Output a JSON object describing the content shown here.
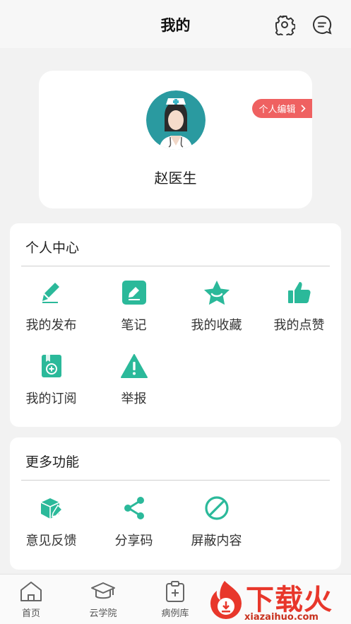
{
  "header": {
    "title": "我的",
    "settings_icon": "gear-icon",
    "message_icon": "message-icon"
  },
  "profile": {
    "name": "赵医生",
    "edit_label": "个人编辑",
    "avatar": "nurse-avatar"
  },
  "personal_center": {
    "title": "个人中心",
    "items": [
      {
        "label": "我的发布",
        "icon": "pencil-icon"
      },
      {
        "label": "笔记",
        "icon": "note-edit-icon"
      },
      {
        "label": "我的收藏",
        "icon": "star-icon"
      },
      {
        "label": "我的点赞",
        "icon": "thumbs-up-icon"
      },
      {
        "label": "我的订阅",
        "icon": "subscribe-book-icon"
      },
      {
        "label": "举报",
        "icon": "warning-icon"
      }
    ]
  },
  "more_functions": {
    "title": "更多功能",
    "items": [
      {
        "label": "意见反馈",
        "icon": "feedback-box-icon"
      },
      {
        "label": "分享码",
        "icon": "share-icon"
      },
      {
        "label": "屏蔽内容",
        "icon": "block-icon"
      }
    ]
  },
  "bottom_nav": {
    "items": [
      {
        "label": "首页",
        "icon": "home-icon"
      },
      {
        "label": "云学院",
        "icon": "graduation-cap-icon"
      },
      {
        "label": "病例库",
        "icon": "clipboard-icon"
      }
    ]
  },
  "watermark": {
    "text": "下载火",
    "url": "xiazaihuo.com"
  },
  "colors": {
    "accent": "#2bb99a",
    "badge": "#ef6161",
    "avatar_bg": "#2a9aa0"
  }
}
